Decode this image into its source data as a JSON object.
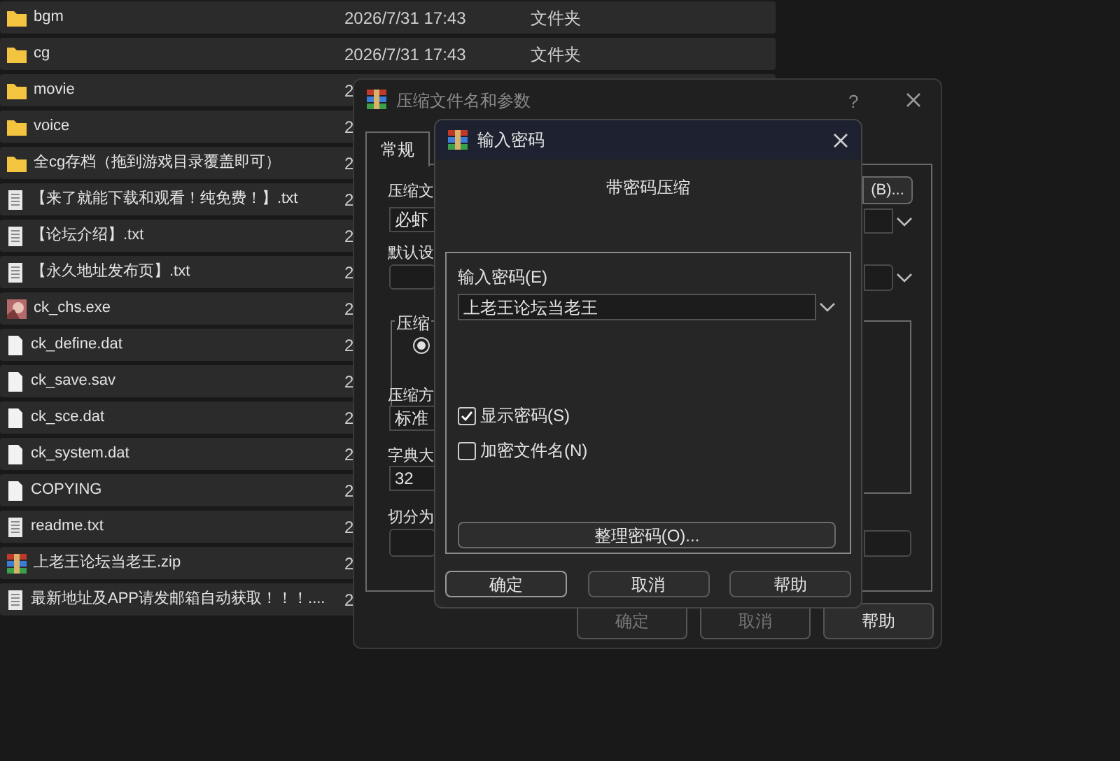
{
  "file_list": [
    {
      "kind": "folder",
      "name": "bgm",
      "date": "2026/7/31 17:43",
      "type": "文件夹"
    },
    {
      "kind": "folder",
      "name": "cg",
      "date": "2026/7/31 17:43",
      "type": "文件夹"
    },
    {
      "kind": "folder",
      "name": "movie",
      "date": "2"
    },
    {
      "kind": "folder",
      "name": "voice",
      "date": "2"
    },
    {
      "kind": "folder",
      "name": "全cg存档（拖到游戏目录覆盖即可）",
      "date": "2"
    },
    {
      "kind": "text",
      "name": "【来了就能下载和观看！纯免费！】.txt",
      "date": "2"
    },
    {
      "kind": "text",
      "name": "【论坛介绍】.txt",
      "date": "2"
    },
    {
      "kind": "text",
      "name": "【永久地址发布页】.txt",
      "date": "2"
    },
    {
      "kind": "exe",
      "name": "ck_chs.exe",
      "date": "2"
    },
    {
      "kind": "file",
      "name": "ck_define.dat",
      "date": "2"
    },
    {
      "kind": "file",
      "name": "ck_save.sav",
      "date": "2"
    },
    {
      "kind": "file",
      "name": "ck_sce.dat",
      "date": "2"
    },
    {
      "kind": "file",
      "name": "ck_system.dat",
      "date": "2"
    },
    {
      "kind": "file",
      "name": "COPYING",
      "date": "2"
    },
    {
      "kind": "text",
      "name": "readme.txt",
      "date": "2"
    },
    {
      "kind": "archive",
      "name": "上老王论坛当老王.zip",
      "date": "2"
    },
    {
      "kind": "text",
      "name": "最新地址及APP请发邮箱自动获取！！！....",
      "date": "2"
    }
  ],
  "archive_dialog": {
    "title": "压缩文件名和参数",
    "help": "?",
    "tabs": [
      {
        "label": "常规",
        "selected": true
      }
    ],
    "archive_name": {
      "label": "压缩文",
      "value": "必虾"
    },
    "browse_button": "(B)...",
    "profile": {
      "label": "默认设"
    },
    "format_group": {
      "label": "压缩",
      "radio_selected": true
    },
    "method": {
      "label": "压缩方",
      "value": "标准"
    },
    "dictionary": {
      "label": "字典大",
      "value": "32"
    },
    "split": {
      "label": "切分为"
    },
    "buttons": [
      {
        "label": "确定",
        "disabled": true
      },
      {
        "label": "取消",
        "disabled": true
      },
      {
        "label": "帮助",
        "disabled": false
      }
    ]
  },
  "password_dialog": {
    "title": "输入密码",
    "heading": "带密码压缩",
    "password": {
      "label": "输入密码(E)",
      "value": "上老王论坛当老王"
    },
    "options": [
      {
        "label": "显示密码(S)",
        "checked": true
      },
      {
        "label": "加密文件名(N)",
        "checked": false
      }
    ],
    "organize_button": "整理密码(O)...",
    "buttons": [
      "确定",
      "取消",
      "帮助"
    ]
  }
}
